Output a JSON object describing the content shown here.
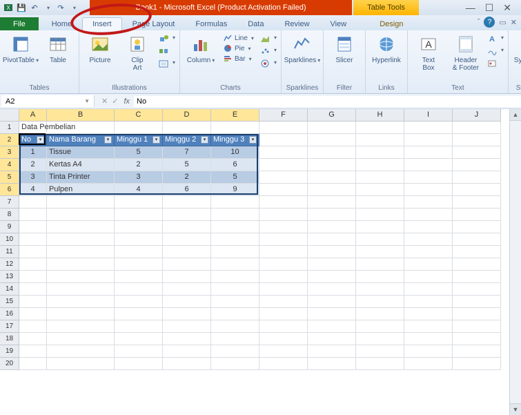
{
  "titlebar": {
    "title": "Book1 - Microsoft Excel (Product Activation Failed)",
    "tableTools": "Table Tools"
  },
  "tabs": {
    "file": "File",
    "items": [
      "Home",
      "Insert",
      "Page Layout",
      "Formulas",
      "Data",
      "Review",
      "View",
      "Design"
    ]
  },
  "ribbon": {
    "tables": {
      "pivot": "PivotTable",
      "table": "Table",
      "label": "Tables"
    },
    "illus": {
      "picture": "Picture",
      "clipart": "Clip\nArt",
      "shapes_items": [
        "",
        "",
        ""
      ],
      "label": "Illustrations"
    },
    "charts": {
      "column": "Column",
      "line": "Line",
      "pie": "Pie",
      "bar": "Bar",
      "label": "Charts"
    },
    "sparklines": {
      "btn": "Sparklines",
      "label": "Sparklines"
    },
    "filter": {
      "slicer": "Slicer",
      "label": "Filter"
    },
    "links": {
      "hyperlink": "Hyperlink",
      "label": "Links"
    },
    "text": {
      "textbox": "Text\nBox",
      "header": "Header\n& Footer",
      "label": "Text"
    },
    "symbols": {
      "btn": "Symbols",
      "label": "Symbols"
    }
  },
  "formula": {
    "name": "A2",
    "value": "No"
  },
  "columns": [
    "A",
    "B",
    "C",
    "D",
    "E",
    "F",
    "G",
    "H",
    "I",
    "J"
  ],
  "sheet": {
    "title": "Data Pembelian",
    "headers": [
      "No",
      "Nama Barang",
      "Minggu 1",
      "Minggu 2",
      "Minggu 3"
    ],
    "rows": [
      {
        "no": "1",
        "nama": "Tissue",
        "m1": "5",
        "m2": "7",
        "m3": "10"
      },
      {
        "no": "2",
        "nama": "Kertas A4",
        "m1": "2",
        "m2": "5",
        "m3": "6"
      },
      {
        "no": "3",
        "nama": "Tinta Printer",
        "m1": "3",
        "m2": "2",
        "m3": "5"
      },
      {
        "no": "4",
        "nama": "Pulpen",
        "m1": "4",
        "m2": "6",
        "m3": "9"
      }
    ]
  },
  "chart_data": {
    "type": "table",
    "title": "Data Pembelian",
    "columns": [
      "No",
      "Nama Barang",
      "Minggu 1",
      "Minggu 2",
      "Minggu 3"
    ],
    "rows": [
      [
        1,
        "Tissue",
        5,
        7,
        10
      ],
      [
        2,
        "Kertas A4",
        2,
        5,
        6
      ],
      [
        3,
        "Tinta Printer",
        3,
        2,
        5
      ],
      [
        4,
        "Pulpen",
        4,
        6,
        9
      ]
    ]
  }
}
